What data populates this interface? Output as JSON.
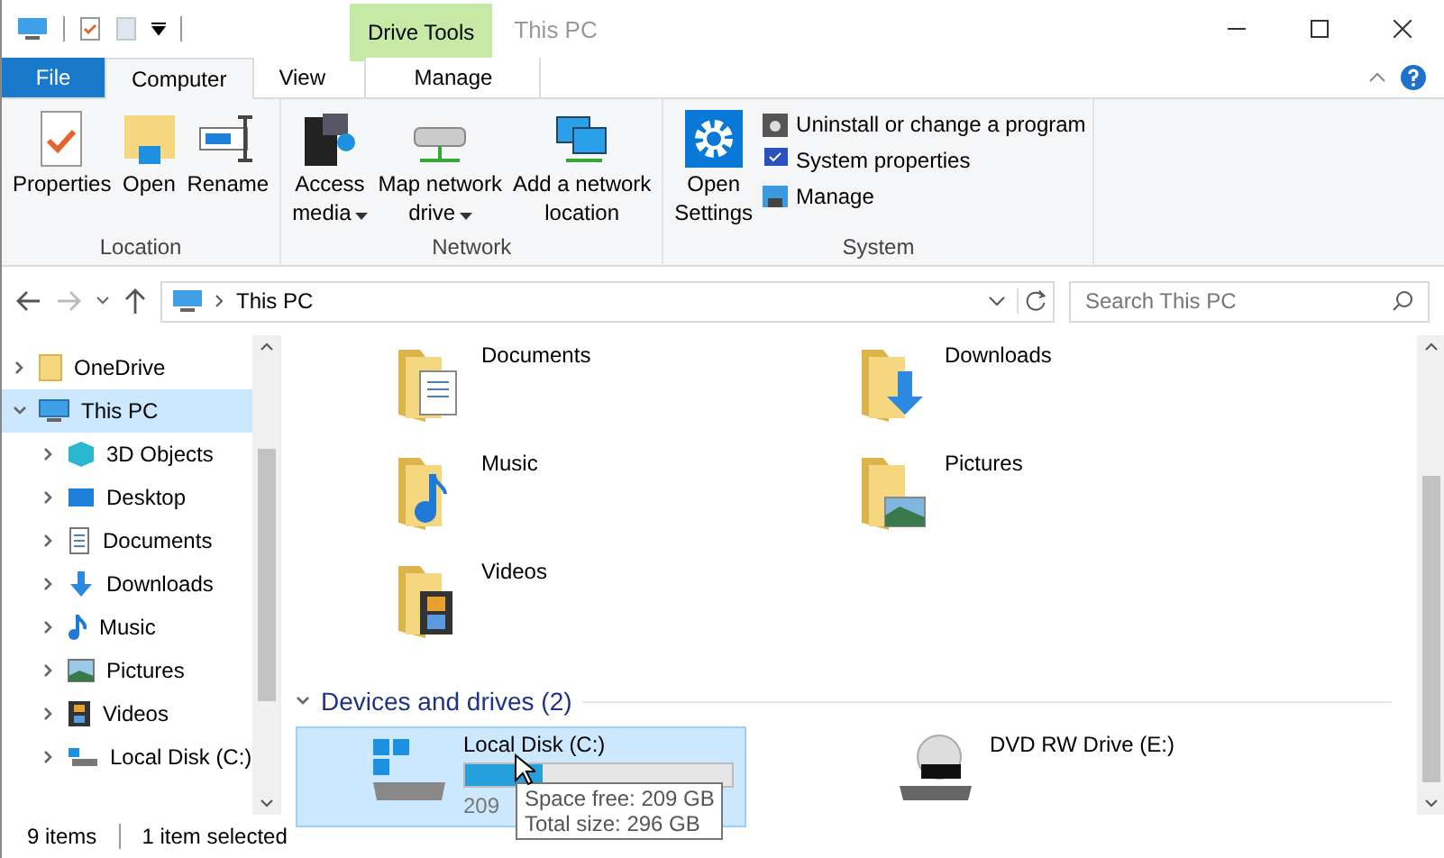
{
  "window": {
    "title": "This PC",
    "context_tab": "Drive Tools"
  },
  "tabs": [
    {
      "label": "File",
      "kind": "file",
      "selected": false
    },
    {
      "label": "Computer",
      "kind": "normal",
      "selected": true
    },
    {
      "label": "View",
      "kind": "normal",
      "selected": false
    },
    {
      "label": "Manage",
      "kind": "context",
      "selected": false
    }
  ],
  "ribbon": {
    "groups": [
      {
        "label": "Location",
        "buttons": [
          {
            "lines": [
              "Properties"
            ],
            "dropdown": false
          },
          {
            "lines": [
              "Open"
            ],
            "dropdown": false
          },
          {
            "lines": [
              "Rename"
            ],
            "dropdown": false
          }
        ]
      },
      {
        "label": "Network",
        "buttons": [
          {
            "lines": [
              "Access",
              "media"
            ],
            "dropdown": true
          },
          {
            "lines": [
              "Map network",
              "drive"
            ],
            "dropdown": true
          },
          {
            "lines": [
              "Add a network",
              "location"
            ],
            "dropdown": false
          }
        ]
      },
      {
        "label": "System",
        "buttons": [
          {
            "lines": [
              "Open",
              "Settings"
            ],
            "dropdown": false
          }
        ],
        "small_items": [
          "Uninstall or change a program",
          "System properties",
          "Manage"
        ]
      }
    ]
  },
  "navigation": {
    "forward_disabled": true,
    "path": [
      "This PC"
    ],
    "search_placeholder": "Search This PC"
  },
  "sidebar": {
    "items": [
      {
        "label": "OneDrive",
        "expanded": false,
        "selected": false
      },
      {
        "label": "This PC",
        "expanded": true,
        "selected": true,
        "children": [
          {
            "label": "3D Objects",
            "expanded": false,
            "selected": false
          },
          {
            "label": "Desktop",
            "expanded": false,
            "selected": false
          },
          {
            "label": "Documents",
            "expanded": false,
            "selected": false
          },
          {
            "label": "Downloads",
            "expanded": false,
            "selected": false
          },
          {
            "label": "Music",
            "expanded": false,
            "selected": false
          },
          {
            "label": "Pictures",
            "expanded": false,
            "selected": false
          },
          {
            "label": "Videos",
            "expanded": false,
            "selected": false
          },
          {
            "label": "Local Disk (C:)",
            "expanded": false,
            "selected": false
          }
        ]
      }
    ]
  },
  "folders": [
    {
      "name": "Documents"
    },
    {
      "name": "Downloads"
    },
    {
      "name": "Music"
    },
    {
      "name": "Pictures"
    },
    {
      "name": "Videos"
    }
  ],
  "drives_group": {
    "title": "Devices and drives (2)",
    "expanded": true
  },
  "drives": [
    {
      "name": "Local Disk (C:)",
      "selected": true,
      "kind": "disk",
      "level": 0.29,
      "free_text": "209"
    },
    {
      "name": "DVD RW Drive (E:)",
      "selected": false,
      "kind": "dvd"
    }
  ],
  "tooltip": [
    "Space free: 209 GB",
    "Total size: 296 GB"
  ],
  "status_bar": {
    "items_count": "9 items",
    "selection": "1 item selected"
  }
}
